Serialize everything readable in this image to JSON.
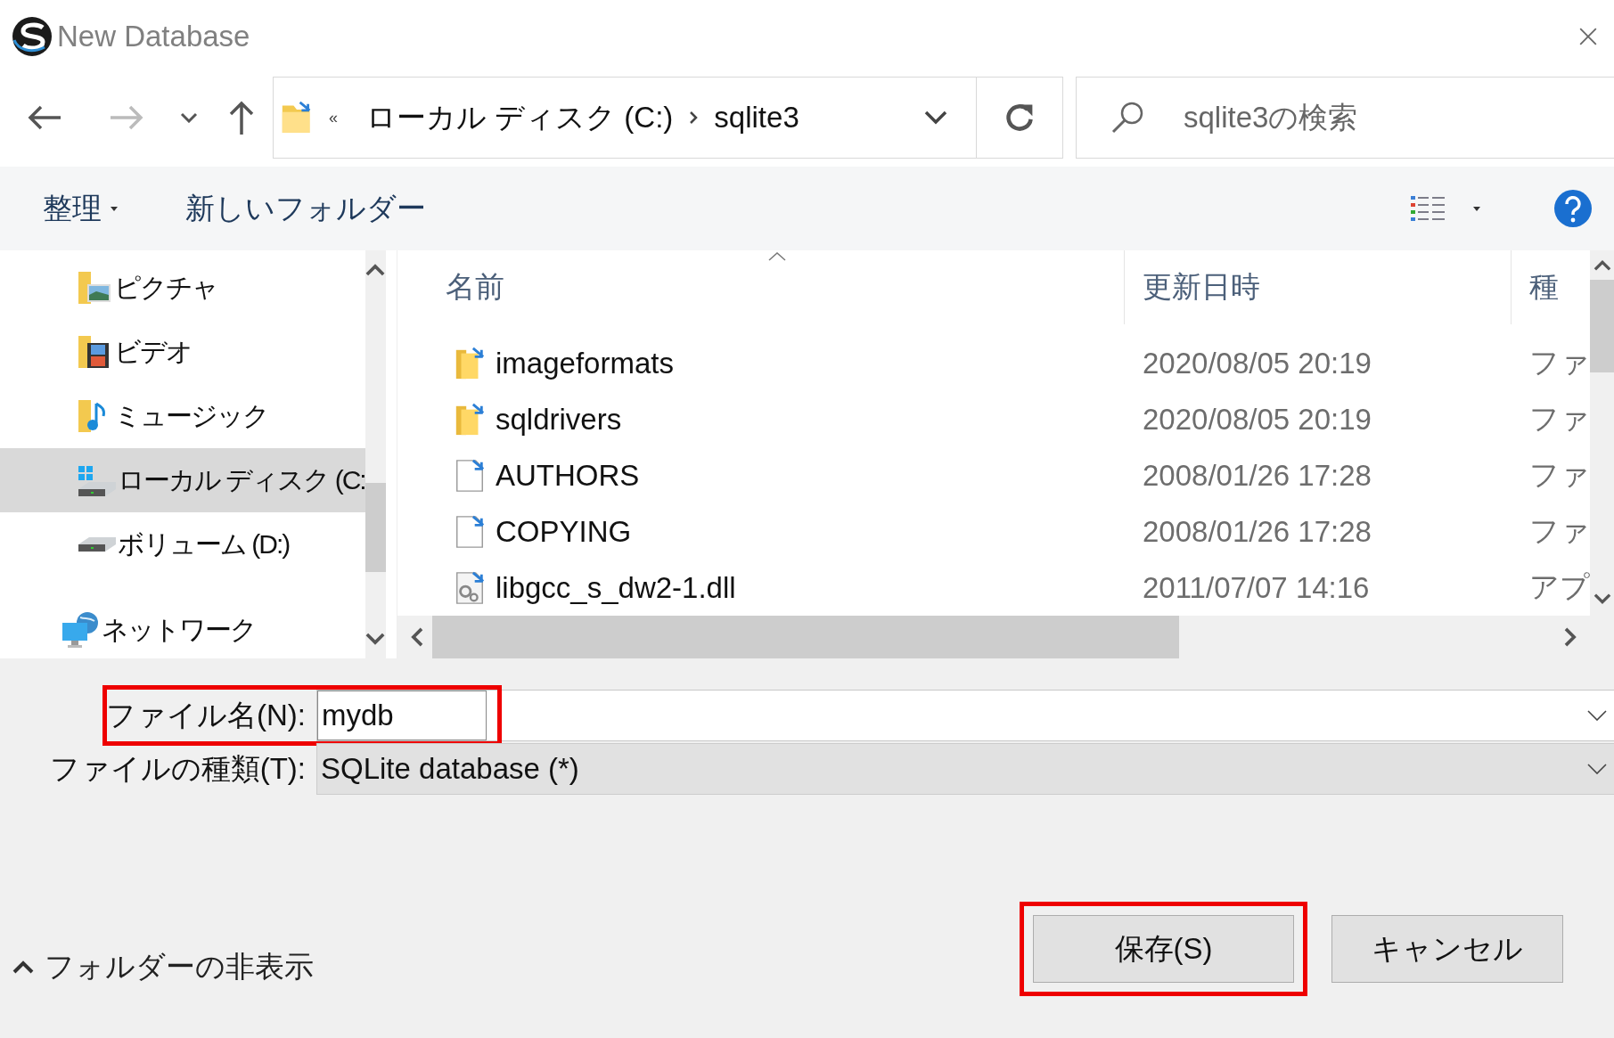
{
  "window": {
    "title": "New Database"
  },
  "address_bar": {
    "overflow": "«",
    "path": [
      "ローカル ディスク (C:)",
      "sqlite3"
    ]
  },
  "search": {
    "placeholder": "sqlite3の検索"
  },
  "toolbar": {
    "organize": "整理",
    "new_folder": "新しいフォルダー"
  },
  "sidebar": {
    "items": [
      {
        "label": "ピクチャ",
        "kind": "pictures",
        "selected": false
      },
      {
        "label": "ビデオ",
        "kind": "videos",
        "selected": false
      },
      {
        "label": "ミュージック",
        "kind": "music",
        "selected": false
      },
      {
        "label": "ローカル ディスク (C:",
        "kind": "system-drive",
        "selected": true
      },
      {
        "label": "ボリューム (D:)",
        "kind": "drive",
        "selected": false
      },
      {
        "label": "ネットワーク",
        "kind": "network",
        "selected": false
      }
    ]
  },
  "file_list": {
    "columns": [
      "名前",
      "更新日時",
      "種"
    ],
    "rows": [
      {
        "name": "imageformats",
        "date": "2020/08/05 20:19",
        "type": "ファ",
        "kind": "folder"
      },
      {
        "name": "sqldrivers",
        "date": "2020/08/05 20:19",
        "type": "ファ",
        "kind": "folder"
      },
      {
        "name": "AUTHORS",
        "date": "2008/01/26 17:28",
        "type": "ファ",
        "kind": "file"
      },
      {
        "name": "COPYING",
        "date": "2008/01/26 17:28",
        "type": "ファ",
        "kind": "file"
      },
      {
        "name": "libgcc_s_dw2-1.dll",
        "date": "2011/07/07 14:16",
        "type": "アプ",
        "kind": "dll"
      }
    ]
  },
  "file_name": {
    "label": "ファイル名(N):",
    "value": "mydb",
    "highlighted": true
  },
  "file_type": {
    "label": "ファイルの種類(T):",
    "value": "SQLite database (*)"
  },
  "hide_folders": "フォルダーの非表示",
  "buttons": [
    {
      "label": "保存(S)",
      "highlighted": true
    },
    {
      "label": "キャンセル",
      "highlighted": false
    }
  ]
}
